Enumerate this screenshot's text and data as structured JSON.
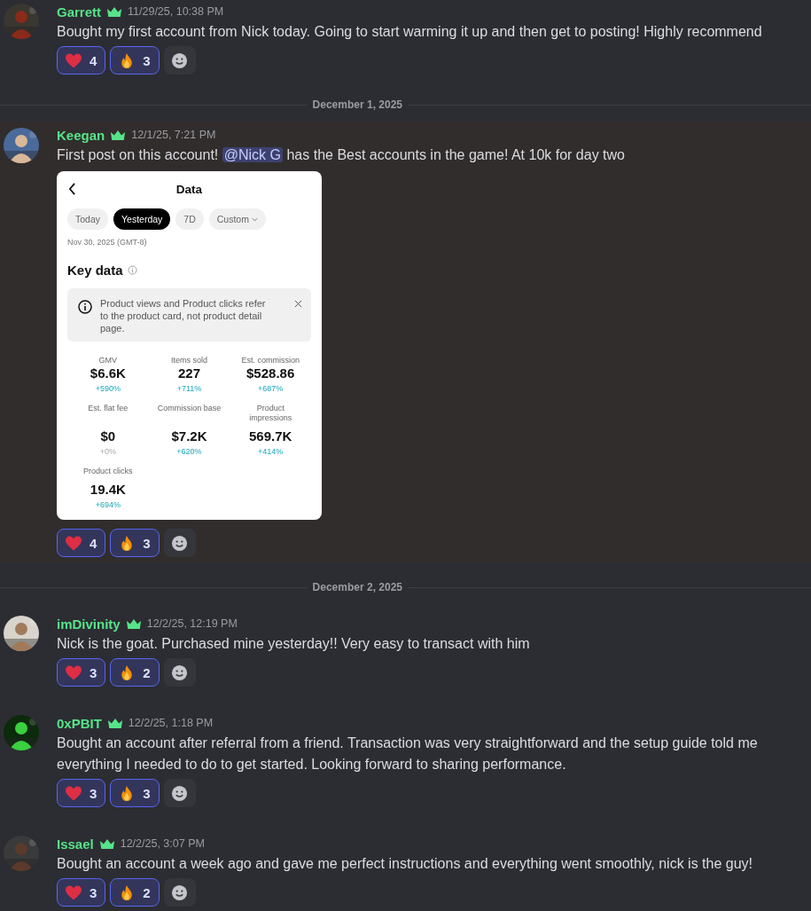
{
  "feed": [
    {
      "kind": "message",
      "author": "Garrett",
      "time": "11/29/25, 10:38 PM",
      "highlighted": false,
      "lines": [
        [
          {
            "kind": "plain",
            "text": "Bought my first account from Nick today. Going to start warming it up and then get to posting! Highly recommend"
          }
        ]
      ],
      "reactions": [
        {
          "kind": "heart",
          "count": "4",
          "selected": true
        },
        {
          "kind": "fire",
          "count": "3",
          "selected": true
        }
      ]
    },
    {
      "kind": "divider",
      "label": "December 1, 2025"
    },
    {
      "kind": "message",
      "author": "Keegan",
      "time": "12/1/25, 7:21 PM",
      "highlighted": true,
      "lines": [
        [
          {
            "kind": "plain",
            "text": "First post on this account! "
          },
          {
            "kind": "mention",
            "text": "@Nick G"
          },
          {
            "kind": "plain",
            "text": " has the Best accounts in the game! At 10k for day two"
          }
        ]
      ],
      "attachment": {
        "title": "Data",
        "tabs": [
          {
            "label": "Today",
            "selected": false
          },
          {
            "label": "Yesterday",
            "selected": true
          },
          {
            "label": "7D",
            "selected": false
          },
          {
            "label": "Custom",
            "selected": false,
            "dropdown": true
          }
        ],
        "date": "Nov 30, 2025 (GMT-8)",
        "heading": "Key data",
        "notice": "Product views and Product clicks refer to the product card, not product detail page.",
        "metrics": [
          {
            "label": "GMV",
            "value": "$6.6K",
            "change": "+590%",
            "muted": false
          },
          {
            "label": "Items sold",
            "value": "227",
            "change": "+711%",
            "muted": false
          },
          {
            "label": "Est. commission",
            "value": "$528.86",
            "change": "+687%",
            "muted": false
          },
          {
            "label": "Est. flat fee",
            "value": "$0",
            "change": "+0%",
            "muted": true
          },
          {
            "label": "Commission base",
            "value": "$7.2K",
            "change": "+620%",
            "muted": false
          },
          {
            "label": "Product impressions",
            "value": "569.7K",
            "change": "+414%",
            "muted": false
          },
          {
            "label": "Product clicks",
            "value": "19.4K",
            "change": "+694%",
            "muted": false
          }
        ]
      },
      "reactions": [
        {
          "kind": "heart",
          "count": "4",
          "selected": true
        },
        {
          "kind": "fire",
          "count": "3",
          "selected": true
        }
      ]
    },
    {
      "kind": "divider",
      "label": "December 2, 2025"
    },
    {
      "kind": "message",
      "author": "imDivinity",
      "time": "12/2/25, 12:19 PM",
      "highlighted": false,
      "lines": [
        [
          {
            "kind": "plain",
            "text": "Nick is the goat. Purchased mine yesterday!! Very easy to transact with him"
          }
        ]
      ],
      "reactions": [
        {
          "kind": "heart",
          "count": "3",
          "selected": true
        },
        {
          "kind": "fire",
          "count": "2",
          "selected": true
        }
      ]
    },
    {
      "kind": "message",
      "author": "0xPBIT",
      "time": "12/2/25, 1:18 PM",
      "highlighted": false,
      "lines": [
        [
          {
            "kind": "plain",
            "text": "Bought an account after referral from a friend. Transaction was very straightforward and the setup guide told me"
          }
        ],
        [
          {
            "kind": "plain",
            "text": "everything I needed to do to get started. Looking forward to sharing performance."
          }
        ]
      ],
      "reactions": [
        {
          "kind": "heart",
          "count": "3",
          "selected": true
        },
        {
          "kind": "fire",
          "count": "3",
          "selected": true
        }
      ]
    },
    {
      "kind": "message",
      "author": "Issael",
      "time": "12/2/25, 3:07 PM",
      "highlighted": false,
      "lines": [
        [
          {
            "kind": "plain",
            "text": "Bought an account a week ago and gave me perfect instructions and everything went smoothly, nick is the guy!"
          }
        ]
      ],
      "reactions": [
        {
          "kind": "heart",
          "count": "3",
          "selected": true
        },
        {
          "kind": "fire",
          "count": "2",
          "selected": true
        }
      ]
    }
  ]
}
